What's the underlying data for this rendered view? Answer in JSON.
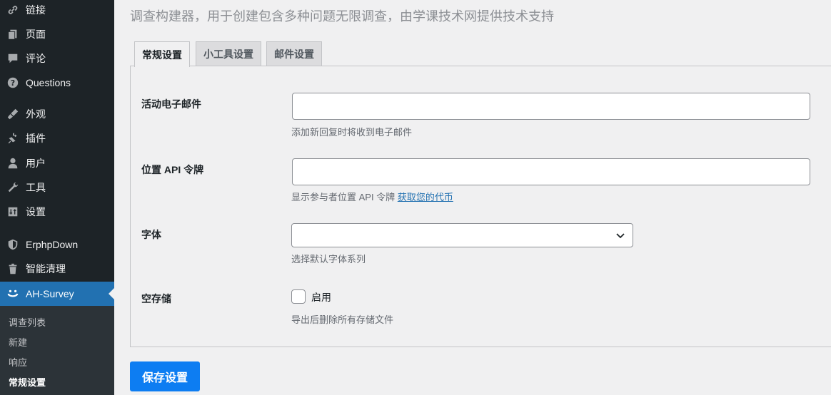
{
  "sidebar": {
    "items": [
      {
        "label": "链接",
        "icon": "link-icon"
      },
      {
        "label": "页面",
        "icon": "pages-icon"
      },
      {
        "label": "评论",
        "icon": "comments-icon"
      },
      {
        "label": "Questions",
        "icon": "question-icon"
      },
      {
        "label": "外观",
        "icon": "appearance-icon"
      },
      {
        "label": "插件",
        "icon": "plugins-icon"
      },
      {
        "label": "用户",
        "icon": "users-icon"
      },
      {
        "label": "工具",
        "icon": "tools-icon"
      },
      {
        "label": "设置",
        "icon": "settings-icon"
      },
      {
        "label": "ErphpDown",
        "icon": "shield-icon"
      },
      {
        "label": "智能清理",
        "icon": "trash-icon"
      },
      {
        "label": "AH-Survey",
        "icon": "smile-icon"
      }
    ],
    "submenu": [
      "调查列表",
      "新建",
      "响应",
      "常规设置"
    ],
    "accent_color": "#2271b1"
  },
  "main": {
    "description": "调查构建器，用于创建包含多种问题无限调查，由学课技术网提供技术支持",
    "tabs": [
      "常规设置",
      "小工具设置",
      "邮件设置"
    ],
    "fields": {
      "email": {
        "label": "活动电子邮件",
        "value": "",
        "help": "添加新回复时将收到电子邮件"
      },
      "api_token": {
        "label": "位置 API 令牌",
        "value": "",
        "help": "显示参与者位置 API 令牌",
        "link": "获取您的代币"
      },
      "font": {
        "label": "字体",
        "value": "",
        "help": "选择默认字体系列"
      },
      "storage": {
        "label": "空存储",
        "checkbox_label": "启用",
        "checked": false,
        "help": "导出后删除所有存储文件"
      }
    },
    "save_label": "保存设置",
    "save_color": "#0d7df2"
  }
}
